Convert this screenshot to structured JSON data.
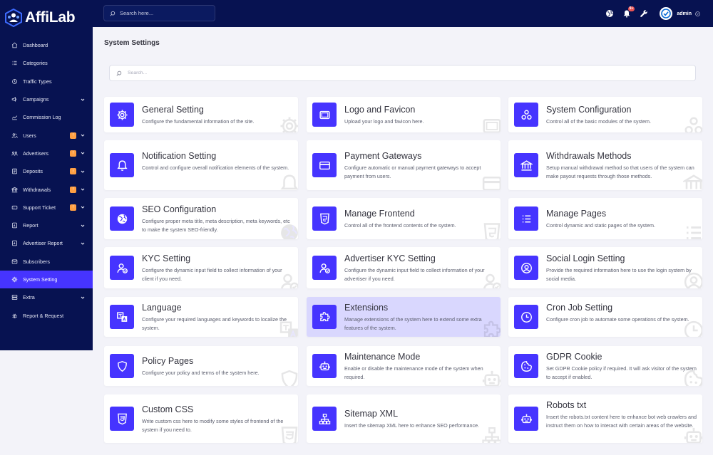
{
  "app": {
    "name": "AffiLab"
  },
  "topbar": {
    "search_placeholder": "Search here...",
    "notification_count": "9+",
    "admin_name": "admin"
  },
  "sidebar": {
    "items": [
      {
        "label": "Dashboard",
        "icon": "home-icon",
        "badge": false,
        "chevron": false,
        "active": false
      },
      {
        "label": "Categories",
        "icon": "list-icon",
        "badge": false,
        "chevron": false,
        "active": false
      },
      {
        "label": "Traffic Types",
        "icon": "traffic-icon",
        "badge": false,
        "chevron": false,
        "active": false
      },
      {
        "label": "Campaigns",
        "icon": "bullhorn-icon",
        "badge": false,
        "chevron": true,
        "active": false
      },
      {
        "label": "Commission Log",
        "icon": "chart-icon",
        "badge": false,
        "chevron": false,
        "active": false
      },
      {
        "label": "Users",
        "icon": "users-icon",
        "badge": true,
        "chevron": true,
        "active": false
      },
      {
        "label": "Advertisers",
        "icon": "advertisers-icon",
        "badge": true,
        "chevron": true,
        "active": false
      },
      {
        "label": "Deposits",
        "icon": "deposit-icon",
        "badge": true,
        "chevron": true,
        "active": false
      },
      {
        "label": "Withdrawals",
        "icon": "bank-icon",
        "badge": true,
        "chevron": true,
        "active": false
      },
      {
        "label": "Support Ticket",
        "icon": "ticket-icon",
        "badge": true,
        "chevron": true,
        "active": false
      },
      {
        "label": "Report",
        "icon": "report-icon",
        "badge": false,
        "chevron": true,
        "active": false
      },
      {
        "label": "Advertiser Report",
        "icon": "report-icon",
        "badge": false,
        "chevron": true,
        "active": false
      },
      {
        "label": "Subscribers",
        "icon": "subscribers-icon",
        "badge": false,
        "chevron": false,
        "active": false
      },
      {
        "label": "System Setting",
        "icon": "gear-icon",
        "badge": false,
        "chevron": false,
        "active": true
      },
      {
        "label": "Extra",
        "icon": "server-icon",
        "badge": false,
        "chevron": true,
        "active": false
      },
      {
        "label": "Report & Request",
        "icon": "bug-icon",
        "badge": false,
        "chevron": false,
        "active": false
      }
    ],
    "badge_text": "!"
  },
  "main": {
    "title": "System Settings",
    "search_placeholder": "Search...",
    "cards": [
      {
        "title": "General Setting",
        "desc": "Configure the fundamental information of the site.",
        "icon": "gear-icon"
      },
      {
        "title": "Logo and Favicon",
        "desc": "Upload your logo and favicon here.",
        "icon": "image-icon"
      },
      {
        "title": "System Configuration",
        "desc": "Control all of the basic modules of the system.",
        "icon": "cubes-icon"
      },
      {
        "title": "Notification Setting",
        "desc": "Control and configure overall notification elements of the system.",
        "icon": "bell-icon"
      },
      {
        "title": "Payment Gateways",
        "desc": "Configure automatic or manual payment gateways to accept payment from users.",
        "icon": "credit-card-icon"
      },
      {
        "title": "Withdrawals Methods",
        "desc": "Setup manual withdrawal method so that users of the system can make payout requests through those methods.",
        "icon": "bank-icon"
      },
      {
        "title": "SEO Configuration",
        "desc": "Configure proper meta title, meta description, meta keywords, etc to make the system SEO-friendly.",
        "icon": "globe-icon"
      },
      {
        "title": "Manage Frontend",
        "desc": "Control all of the frontend contents of the system.",
        "icon": "html5-icon"
      },
      {
        "title": "Manage Pages",
        "desc": "Control dynamic and static pages of the system.",
        "icon": "list-icon"
      },
      {
        "title": "KYC Setting",
        "desc": "Configure the dynamic input field to collect information of your client if you need.",
        "icon": "user-check-icon"
      },
      {
        "title": "Advertiser KYC Setting",
        "desc": "Configure the dynamic input field to collect information of your advertiser if you need.",
        "icon": "user-check-icon"
      },
      {
        "title": "Social Login Setting",
        "desc": "Provide the required information here to use the login system by social media.",
        "icon": "user-circle-icon"
      },
      {
        "title": "Language",
        "desc": "Configure your required languages and keywords to localize the system.",
        "icon": "language-icon"
      },
      {
        "title": "Extensions",
        "desc": "Manage extensions of the system here to extend some extra features of the system.",
        "icon": "puzzle-icon"
      },
      {
        "title": "Cron Job Setting",
        "desc": "Configure cron job to automate some operations of the system.",
        "icon": "clock-icon"
      },
      {
        "title": "Policy Pages",
        "desc": "Configure your policy and terms of the system here.",
        "icon": "shield-icon"
      },
      {
        "title": "Maintenance Mode",
        "desc": "Enable or disable the maintenance mode of the system when required.",
        "icon": "robot-icon"
      },
      {
        "title": "GDPR Cookie",
        "desc": "Set GDPR Cookie policy if required. It will ask visitor of the system to accept if enabled.",
        "icon": "cookie-icon"
      },
      {
        "title": "Custom CSS",
        "desc": "Write custom css here to modify some styles of frontend of the system if you need to.",
        "icon": "css3-icon"
      },
      {
        "title": "Sitemap XML",
        "desc": "Insert the sitemap XML here to enhance SEO performance.",
        "icon": "sitemap-icon"
      },
      {
        "title": "Robots txt",
        "desc": "Insert the robots.txt content here to enhance bot web crawlers and instruct them on how to interact with certain areas of the website.",
        "icon": "robot-icon"
      }
    ]
  },
  "colors": {
    "sidebar_bg": "#071251",
    "accent": "#4634ff",
    "badge": "#ff9f43",
    "page_bg": "#f3f3f9",
    "highlight": "#d9d7fe"
  }
}
